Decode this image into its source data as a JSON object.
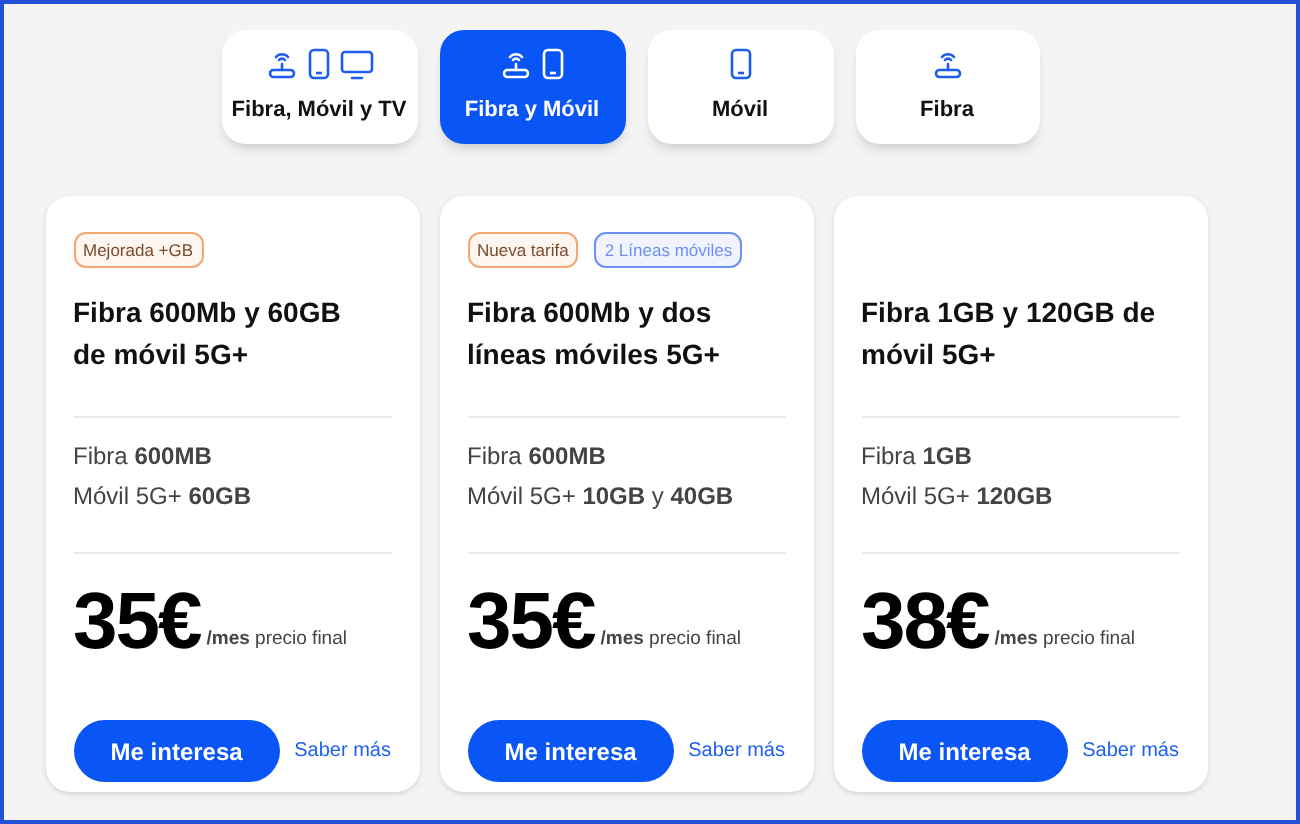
{
  "tabs": [
    {
      "label": "Fibra, Móvil y TV",
      "kind": "all",
      "selected": false
    },
    {
      "label": "Fibra y Móvil",
      "kind": "fibra-movil",
      "selected": true
    },
    {
      "label": "Móvil",
      "kind": "movil",
      "selected": false
    },
    {
      "label": "Fibra",
      "kind": "fibra",
      "selected": false
    }
  ],
  "plans": [
    {
      "badges": [
        {
          "text": "Mejorada +GB",
          "color": "#f5a56e"
        }
      ],
      "title": "Fibra 600Mb y 60GB de móvil 5G+",
      "features": [
        "Fibra **600MB**",
        "Móvil 5G+ **60GB**"
      ],
      "price": "35€",
      "price_note": "**/mes** precio final",
      "button": "Me interesa",
      "link": "Saber más"
    },
    {
      "badges": [
        {
          "text": "Nueva tarifa",
          "color": "#f5a56e"
        },
        {
          "text": "2 Líneas móviles",
          "color": "#6b8ff5"
        }
      ],
      "title": "Fibra 600Mb y dos líneas móviles 5G+",
      "features": [
        "Fibra **600MB**",
        "Móvil 5G+ **10GB** y **40GB**"
      ],
      "price": "35€",
      "price_note": "**/mes** precio final",
      "button": "Me interesa",
      "link": "Saber más"
    },
    {
      "title": "Fibra 1GB y 120GB de móvil 5G+",
      "features": [
        "Fibra **1GB**",
        "Móvil 5G+ **120GB**"
      ],
      "price": "38€",
      "price_note": "**/mes** precio final",
      "button": "Me interesa",
      "link": "Saber más"
    }
  ]
}
